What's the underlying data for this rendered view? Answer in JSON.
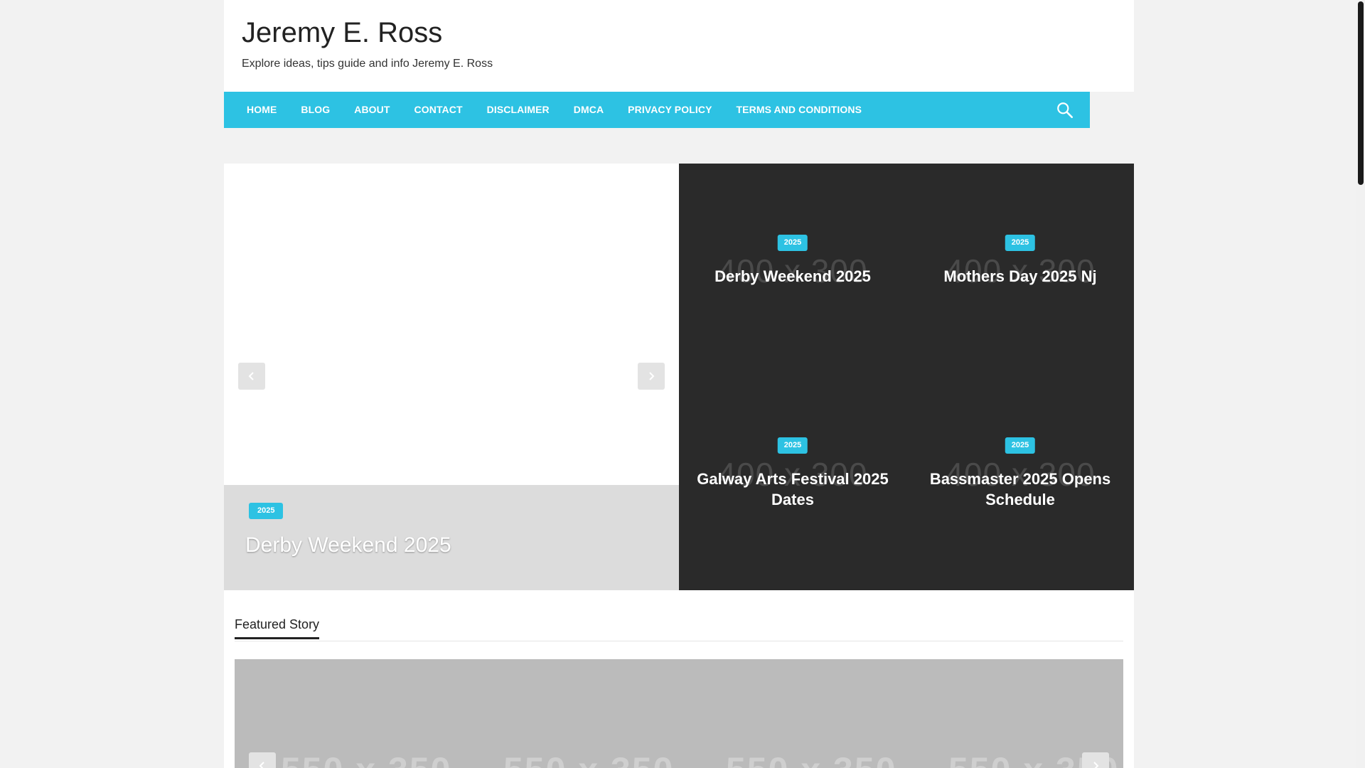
{
  "header": {
    "site_title": "Jeremy E. Ross",
    "tagline": "Explore ideas, tips guide and info Jeremy E. Ross"
  },
  "nav": {
    "items": [
      {
        "label": "HOME"
      },
      {
        "label": "BLOG"
      },
      {
        "label": "ABOUT"
      },
      {
        "label": "CONTACT"
      },
      {
        "label": "DISCLAIMER"
      },
      {
        "label": "DMCA"
      },
      {
        "label": "PRIVACY POLICY"
      },
      {
        "label": "TERMS AND CONDITIONS"
      }
    ],
    "search_icon": "search-icon"
  },
  "slider": {
    "badge": "2025",
    "title": "Derby Weekend 2025"
  },
  "grid": {
    "placeholder": "400 x 300",
    "cards": [
      {
        "badge": "2025",
        "title": "Derby Weekend 2025"
      },
      {
        "badge": "2025",
        "title": "Mothers Day 2025 Nj"
      },
      {
        "badge": "2025",
        "title": "Galway Arts Festival 2025 Dates"
      },
      {
        "badge": "2025",
        "title": "Bassmaster 2025 Opens Schedule"
      }
    ]
  },
  "featured": {
    "heading": "Featured Story",
    "placeholders": [
      "550 x 350",
      "550 x 350",
      "550 x 350",
      "550 x 350"
    ]
  },
  "colors": {
    "accent": "#2dc2e3",
    "dark_panel": "#2a2a2a"
  }
}
